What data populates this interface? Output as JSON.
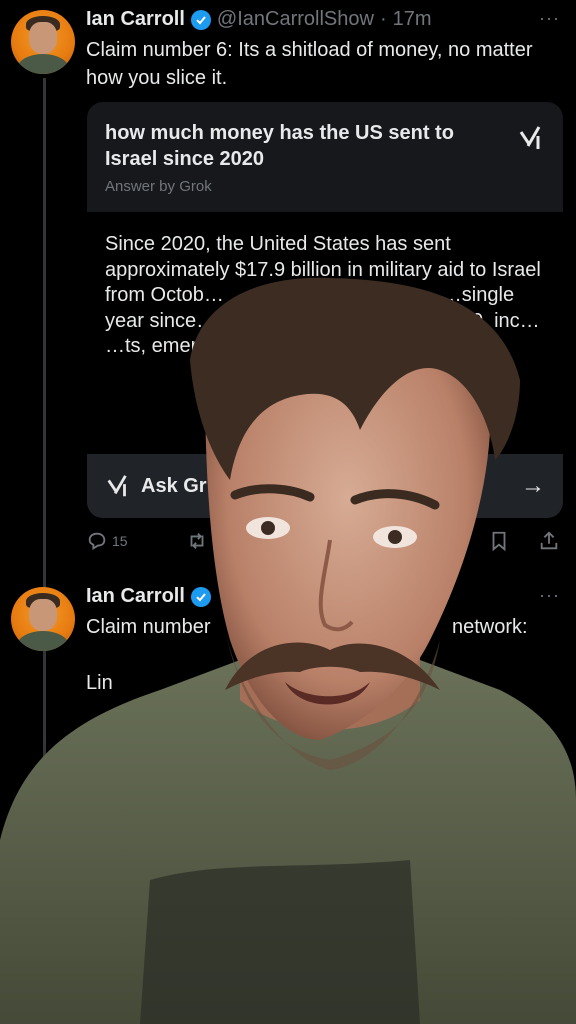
{
  "tweet1": {
    "name": "Ian Carroll",
    "handle": "@IanCarrollShow",
    "separator": "·",
    "time": "17m",
    "text": "Claim number 6: Its a shitload of money, no matter how you slice it.",
    "more": "···",
    "reply_count": "15"
  },
  "grok_card": {
    "question": "how much money has the US sent to Israel since 2020",
    "byline": "Answer by Grok",
    "answer": "Since 2020, the United States has sent approximately $17.9 billion in military aid to Israel from Octob… …one, representing t… …single year since… …to Israel in 1… …ince 2020, inc… …ts, emergenc… …ic...",
    "ask_label": "Ask Gr",
    "arrow": "→"
  },
  "tweet2": {
    "name": "Ian Carroll",
    "more": "···",
    "text_left": "Claim number",
    "text_right": "network:",
    "text_line2": "Lin"
  }
}
